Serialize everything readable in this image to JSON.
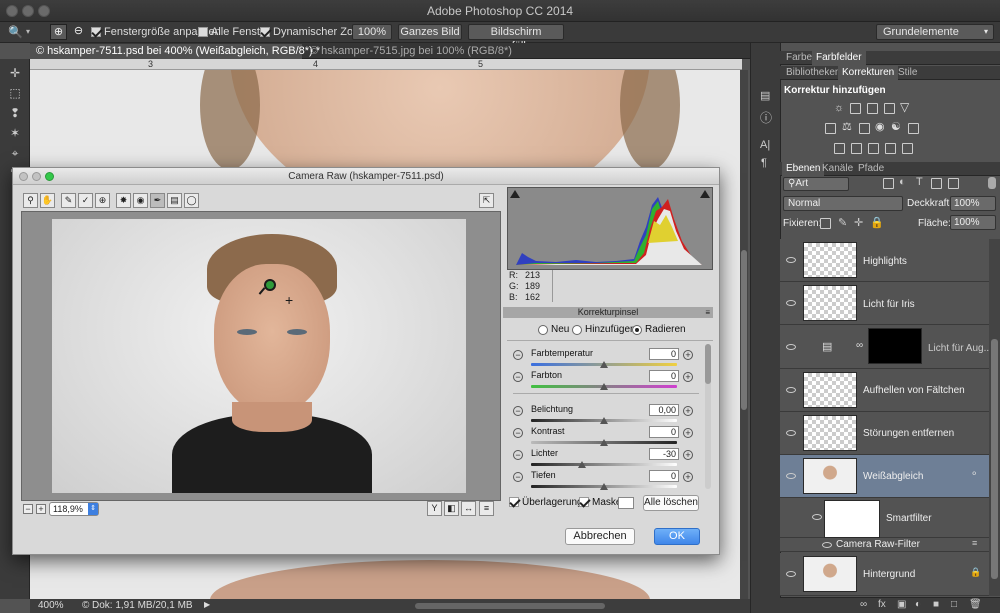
{
  "app": {
    "title": "Adobe Photoshop CC 2014"
  },
  "options": {
    "fit_window_label": "Fenstergröße anpassen",
    "all_windows_label": "Alle Fenster",
    "dynamic_zoom_label": "Dynamischer Zoom",
    "zoom_100": "100%",
    "whole_image": "Ganzes Bild",
    "fill_screen": "Bildschirm ausfüllen",
    "workspace": "Grundelemente"
  },
  "tabs": [
    {
      "label": "© hskamper-7511.psd bei 400% (Weißabgleich, RGB/8*) *",
      "active": true
    },
    {
      "label": "© hskamper-7515.jpg bei 100% (RGB/8*)",
      "active": false
    }
  ],
  "ruler": {
    "ticks": [
      "3",
      "4",
      "5"
    ]
  },
  "status": {
    "zoom": "400%",
    "doc": "Dok: 1,91 MB/20,1 MB"
  },
  "panel_top": {
    "tabs": [
      "Farbe",
      "Farbfelder"
    ]
  },
  "panel_adjust": {
    "tabs": [
      "Bibliotheken",
      "Korrekturen",
      "Stile"
    ],
    "title": "Korrektur hinzufügen"
  },
  "panel_layers": {
    "tabs": [
      "Ebenen",
      "Kanäle",
      "Pfade"
    ],
    "filter": "Art",
    "blend_mode": "Normal",
    "opacity_label": "Deckkraft:",
    "opacity": "100%",
    "lock_label": "Fixieren:",
    "fill_label": "Fläche:",
    "fill": "100%",
    "layers": [
      {
        "name": "Highlights"
      },
      {
        "name": "Licht für Iris"
      },
      {
        "name": "Licht für Aug..."
      },
      {
        "name": "Aufhellen von Fältchen"
      },
      {
        "name": "Störungen entfernen"
      },
      {
        "name": "Weißabgleich"
      },
      {
        "name": "Smartfilter"
      },
      {
        "name": "Camera Raw-Filter"
      },
      {
        "name": "Hintergrund"
      }
    ]
  },
  "dialog": {
    "title": "Camera Raw (hskamper-7511.psd)",
    "zoom": "118,9%",
    "rgb": {
      "r_label": "R:",
      "r": "213",
      "g_label": "G:",
      "g": "189",
      "b_label": "B:",
      "b": "162"
    },
    "panel_title": "Korrekturpinsel",
    "modes": {
      "new": "Neu",
      "add": "Hinzufügen",
      "erase": "Radieren"
    },
    "sliders": [
      {
        "label": "Farbtemperatur",
        "value": "0",
        "pos": 0.5
      },
      {
        "label": "Farbton",
        "value": "0",
        "pos": 0.5
      },
      {
        "label": "Belichtung",
        "value": "0,00",
        "pos": 0.5
      },
      {
        "label": "Kontrast",
        "value": "0",
        "pos": 0.5
      },
      {
        "label": "Lichter",
        "value": "-30",
        "pos": 0.35
      },
      {
        "label": "Tiefen",
        "value": "0",
        "pos": 0.5
      }
    ],
    "overlay_label": "Überlagerung",
    "mask_label": "Maske",
    "clear_all": "Alle löschen",
    "cancel": "Abbrechen",
    "ok": "OK"
  }
}
